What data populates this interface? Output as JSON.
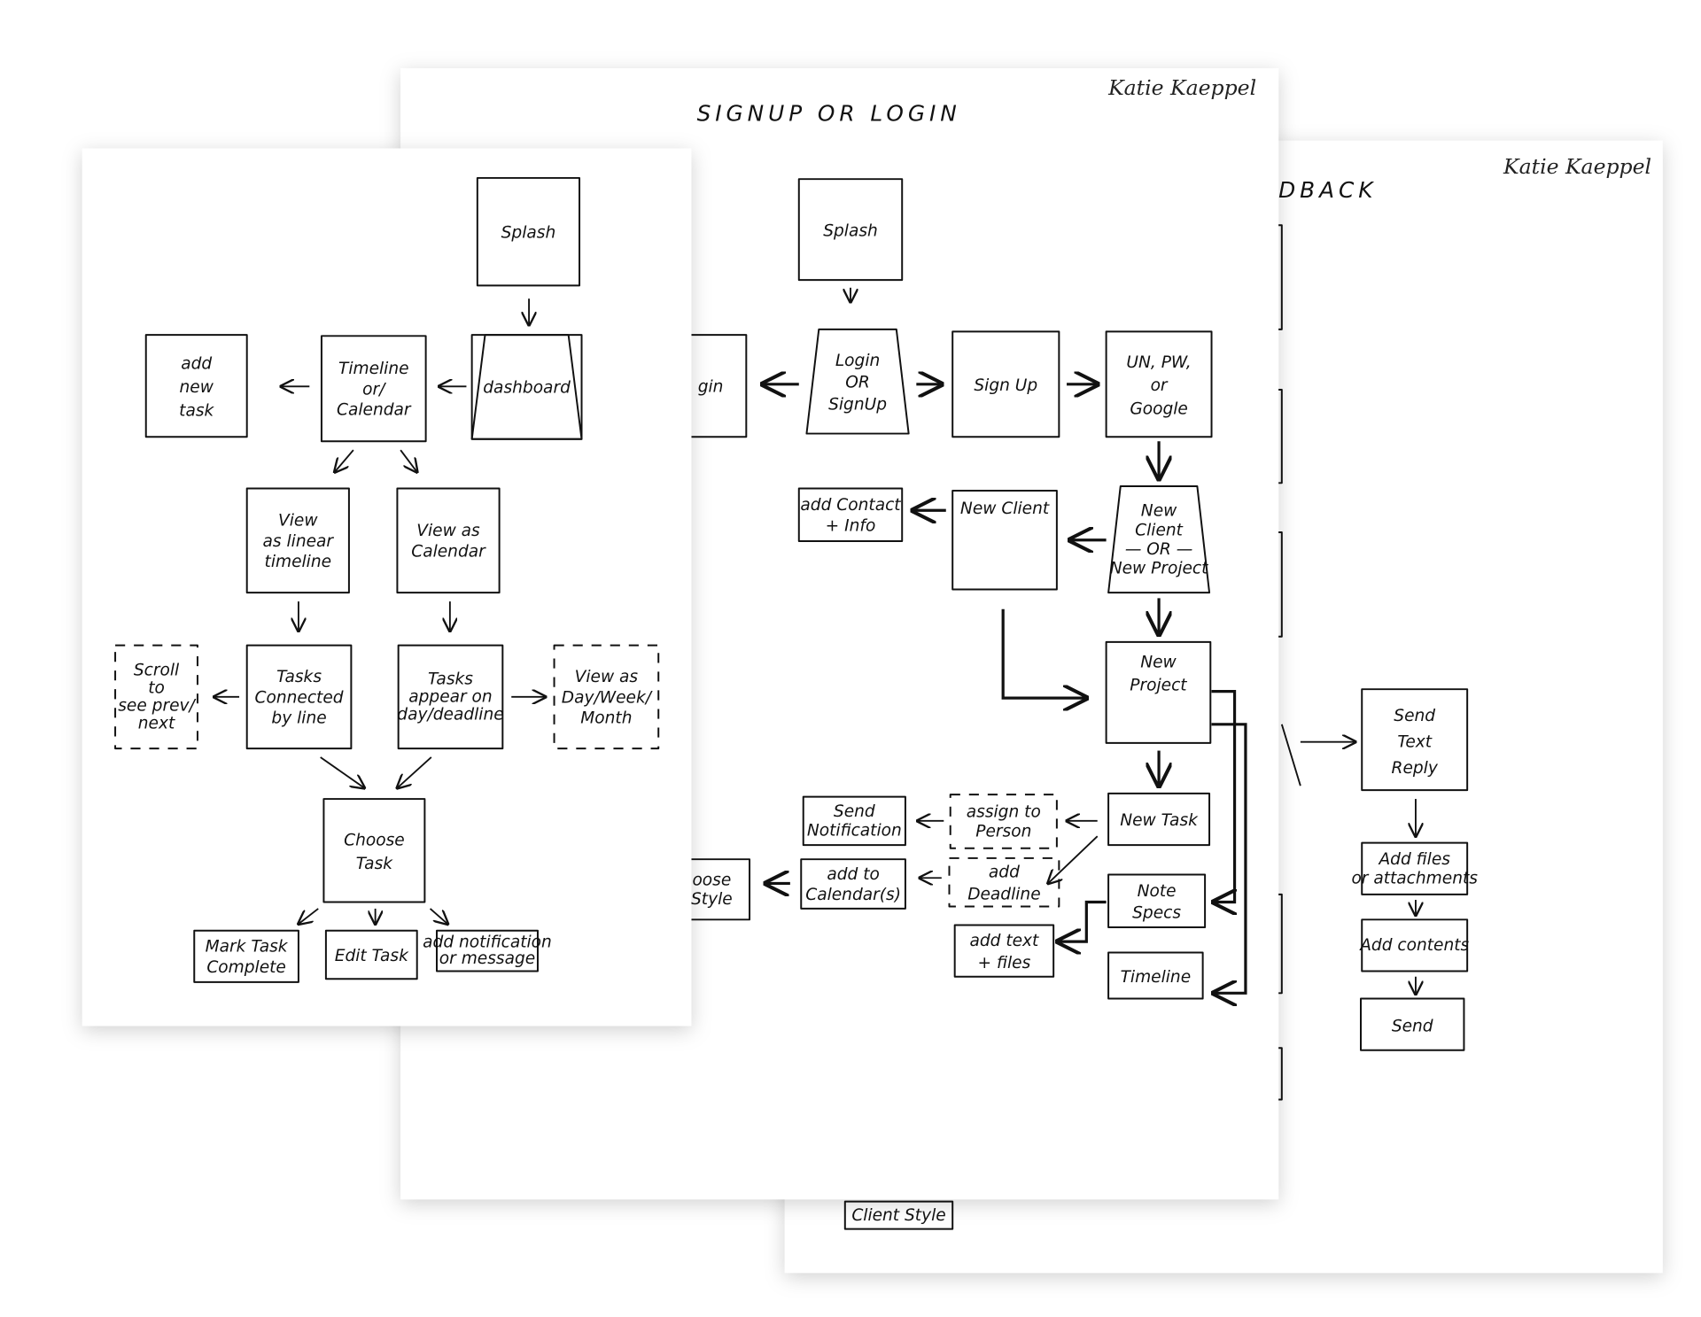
{
  "signatures": {
    "middle": "Katie Kaeppel",
    "right": "Katie Kaeppel"
  },
  "sheets": {
    "right": {
      "title_fragment": "DBACK",
      "nodes": {
        "send_text_reply": [
          "Send",
          "Text",
          "Reply"
        ],
        "add_files": [
          "Add files",
          "or attachments"
        ],
        "add_contents": [
          "Add contents"
        ],
        "send": [
          "Send"
        ],
        "client_style": [
          "Client Style"
        ]
      }
    },
    "middle": {
      "title": "SIGNUP OR LOGIN",
      "nodes": {
        "splash": [
          "Splash"
        ],
        "login_partial": [
          "gin"
        ],
        "login_or_signup": [
          "Login",
          "OR",
          "SignUp"
        ],
        "sign_up": [
          "Sign Up"
        ],
        "un_pw_google": [
          "UN, PW,",
          "or",
          "Google"
        ],
        "add_contact_info": [
          "add Contact",
          "+ Info"
        ],
        "new_client": [
          "New Client"
        ],
        "new_client_or_project": [
          "New",
          "Client",
          "— OR —",
          "New Project"
        ],
        "new_project": [
          "New",
          "Project"
        ],
        "new_task": [
          "New Task"
        ],
        "note_specs": [
          "Note",
          "Specs"
        ],
        "timeline": [
          "Timeline"
        ],
        "add_text_files": [
          "add text",
          "+ files"
        ],
        "assign_to_person": [
          "assign to",
          "Person"
        ],
        "add_deadline": [
          "add",
          "Deadline"
        ],
        "send_notification": [
          "Send",
          "Notification"
        ],
        "add_to_calendars": [
          "add to",
          "Calendar(s)"
        ],
        "choose_style_partial": [
          "oose",
          "Style"
        ]
      }
    },
    "left": {
      "nodes": {
        "splash": [
          "Splash"
        ],
        "dashboard": [
          "dashboard"
        ],
        "timeline_or_calendar": [
          "Timeline",
          "or/",
          "Calendar"
        ],
        "add_new_task": [
          "add",
          "new",
          "task"
        ],
        "view_linear_timeline": [
          "View",
          "as linear",
          "timeline"
        ],
        "view_as_calendar": [
          "View as",
          "Calendar"
        ],
        "scroll_prev_next": [
          "Scroll",
          "to",
          "see prev/",
          "next"
        ],
        "tasks_connected": [
          "Tasks",
          "Connected",
          "by line"
        ],
        "tasks_appear": [
          "Tasks",
          "appear on",
          "day/deadline"
        ],
        "view_day_week_month": [
          "View as",
          "Day/Week/",
          "Month"
        ],
        "choose_task": [
          "Choose",
          "Task"
        ],
        "mark_task_complete": [
          "Mark Task",
          "Complete"
        ],
        "edit_task": [
          "Edit Task"
        ],
        "add_notification": [
          "add notification",
          "or message"
        ]
      }
    }
  }
}
